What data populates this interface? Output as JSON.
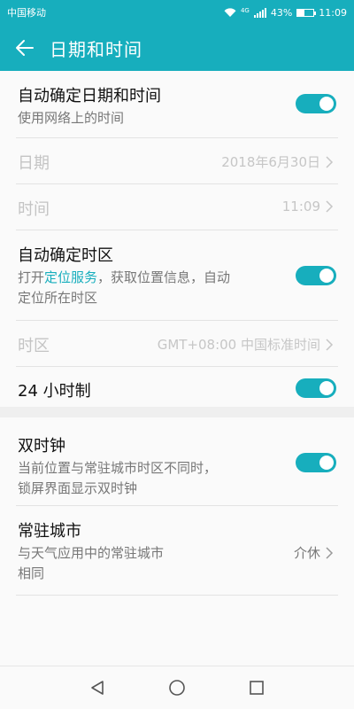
{
  "status_bar": {
    "carrier": "中国移动",
    "network_type": "4G",
    "battery": "43%",
    "battery_level": 0.43,
    "time": "11:09"
  },
  "app_bar": {
    "title": "日期和时间",
    "back_icon": "arrow-left-icon"
  },
  "settings": {
    "auto_datetime": {
      "title": "自动确定日期和时间",
      "subtitle": "使用网络上的时间",
      "enabled": true
    },
    "date": {
      "title": "日期",
      "value": "2018年6月30日"
    },
    "time": {
      "title": "时间",
      "value": "11:09"
    },
    "auto_timezone": {
      "title": "自动确定时区",
      "subtitle_prefix": "打开",
      "subtitle_link": "定位服务",
      "subtitle_rest_line1": "，获取位置信息，自动",
      "subtitle_line2": "定位所在时区",
      "enabled": true
    },
    "timezone": {
      "title": "时区",
      "value": "GMT+08:00 中国标准时间"
    },
    "hour24": {
      "title": "24 小时制",
      "enabled": true
    },
    "dual_clock": {
      "title": "双时钟",
      "subtitle_line1": "当前位置与常驻城市时区不同时，",
      "subtitle_line2": "锁屏界面显示双时钟",
      "enabled": true
    },
    "home_city": {
      "title": "常驻城市",
      "subtitle_line1": "与天气应用中的常驻城市",
      "subtitle_line2": "相同",
      "value": "介休"
    }
  },
  "nav_bar": {
    "back": "triangle-back-icon",
    "home": "circle-home-icon",
    "recents": "square-recents-icon"
  },
  "colors": {
    "accent": "#17aebd",
    "background": "#fafafa"
  }
}
